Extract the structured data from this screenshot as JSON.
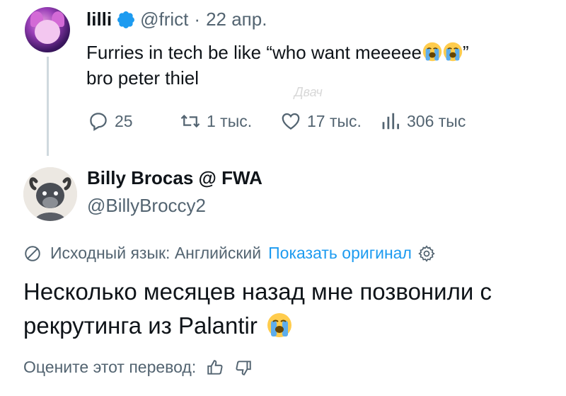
{
  "tweet": {
    "author_name": "lilli",
    "author_handle": "@frict",
    "separator": "·",
    "date": "22 апр.",
    "text_line1": "Furries in tech be like “who want meeeee",
    "text_line1_end": "”",
    "text_line2": "bro peter thiel",
    "stats": {
      "replies": "25",
      "reposts": "1 тыс.",
      "likes": "17 тыс.",
      "views": "306 тыс"
    }
  },
  "watermark": "Двач",
  "reply": {
    "author_name": "Billy Brocas @ FWA",
    "author_handle": "@BillyBroccy2",
    "source_language_label": "Исходный язык: Английский",
    "show_original": "Показать оригинал",
    "text_line1": "Несколько месяцев назад мне позвонили с",
    "text_line2": "рекрутинга из Palantir",
    "rate_translation": "Оцените этот перевод:"
  },
  "colors": {
    "secondary_text": "#536471",
    "link_blue": "#1d9bf0",
    "verified_blue": "#1d9bf0",
    "thread_line": "#cfd9de"
  },
  "icons": [
    "verified-badge-icon",
    "reply-icon",
    "repost-icon",
    "like-icon",
    "views-icon",
    "translate-icon",
    "gear-icon",
    "thumbs-up-icon",
    "thumbs-down-icon",
    "crying-emoji-icon"
  ]
}
